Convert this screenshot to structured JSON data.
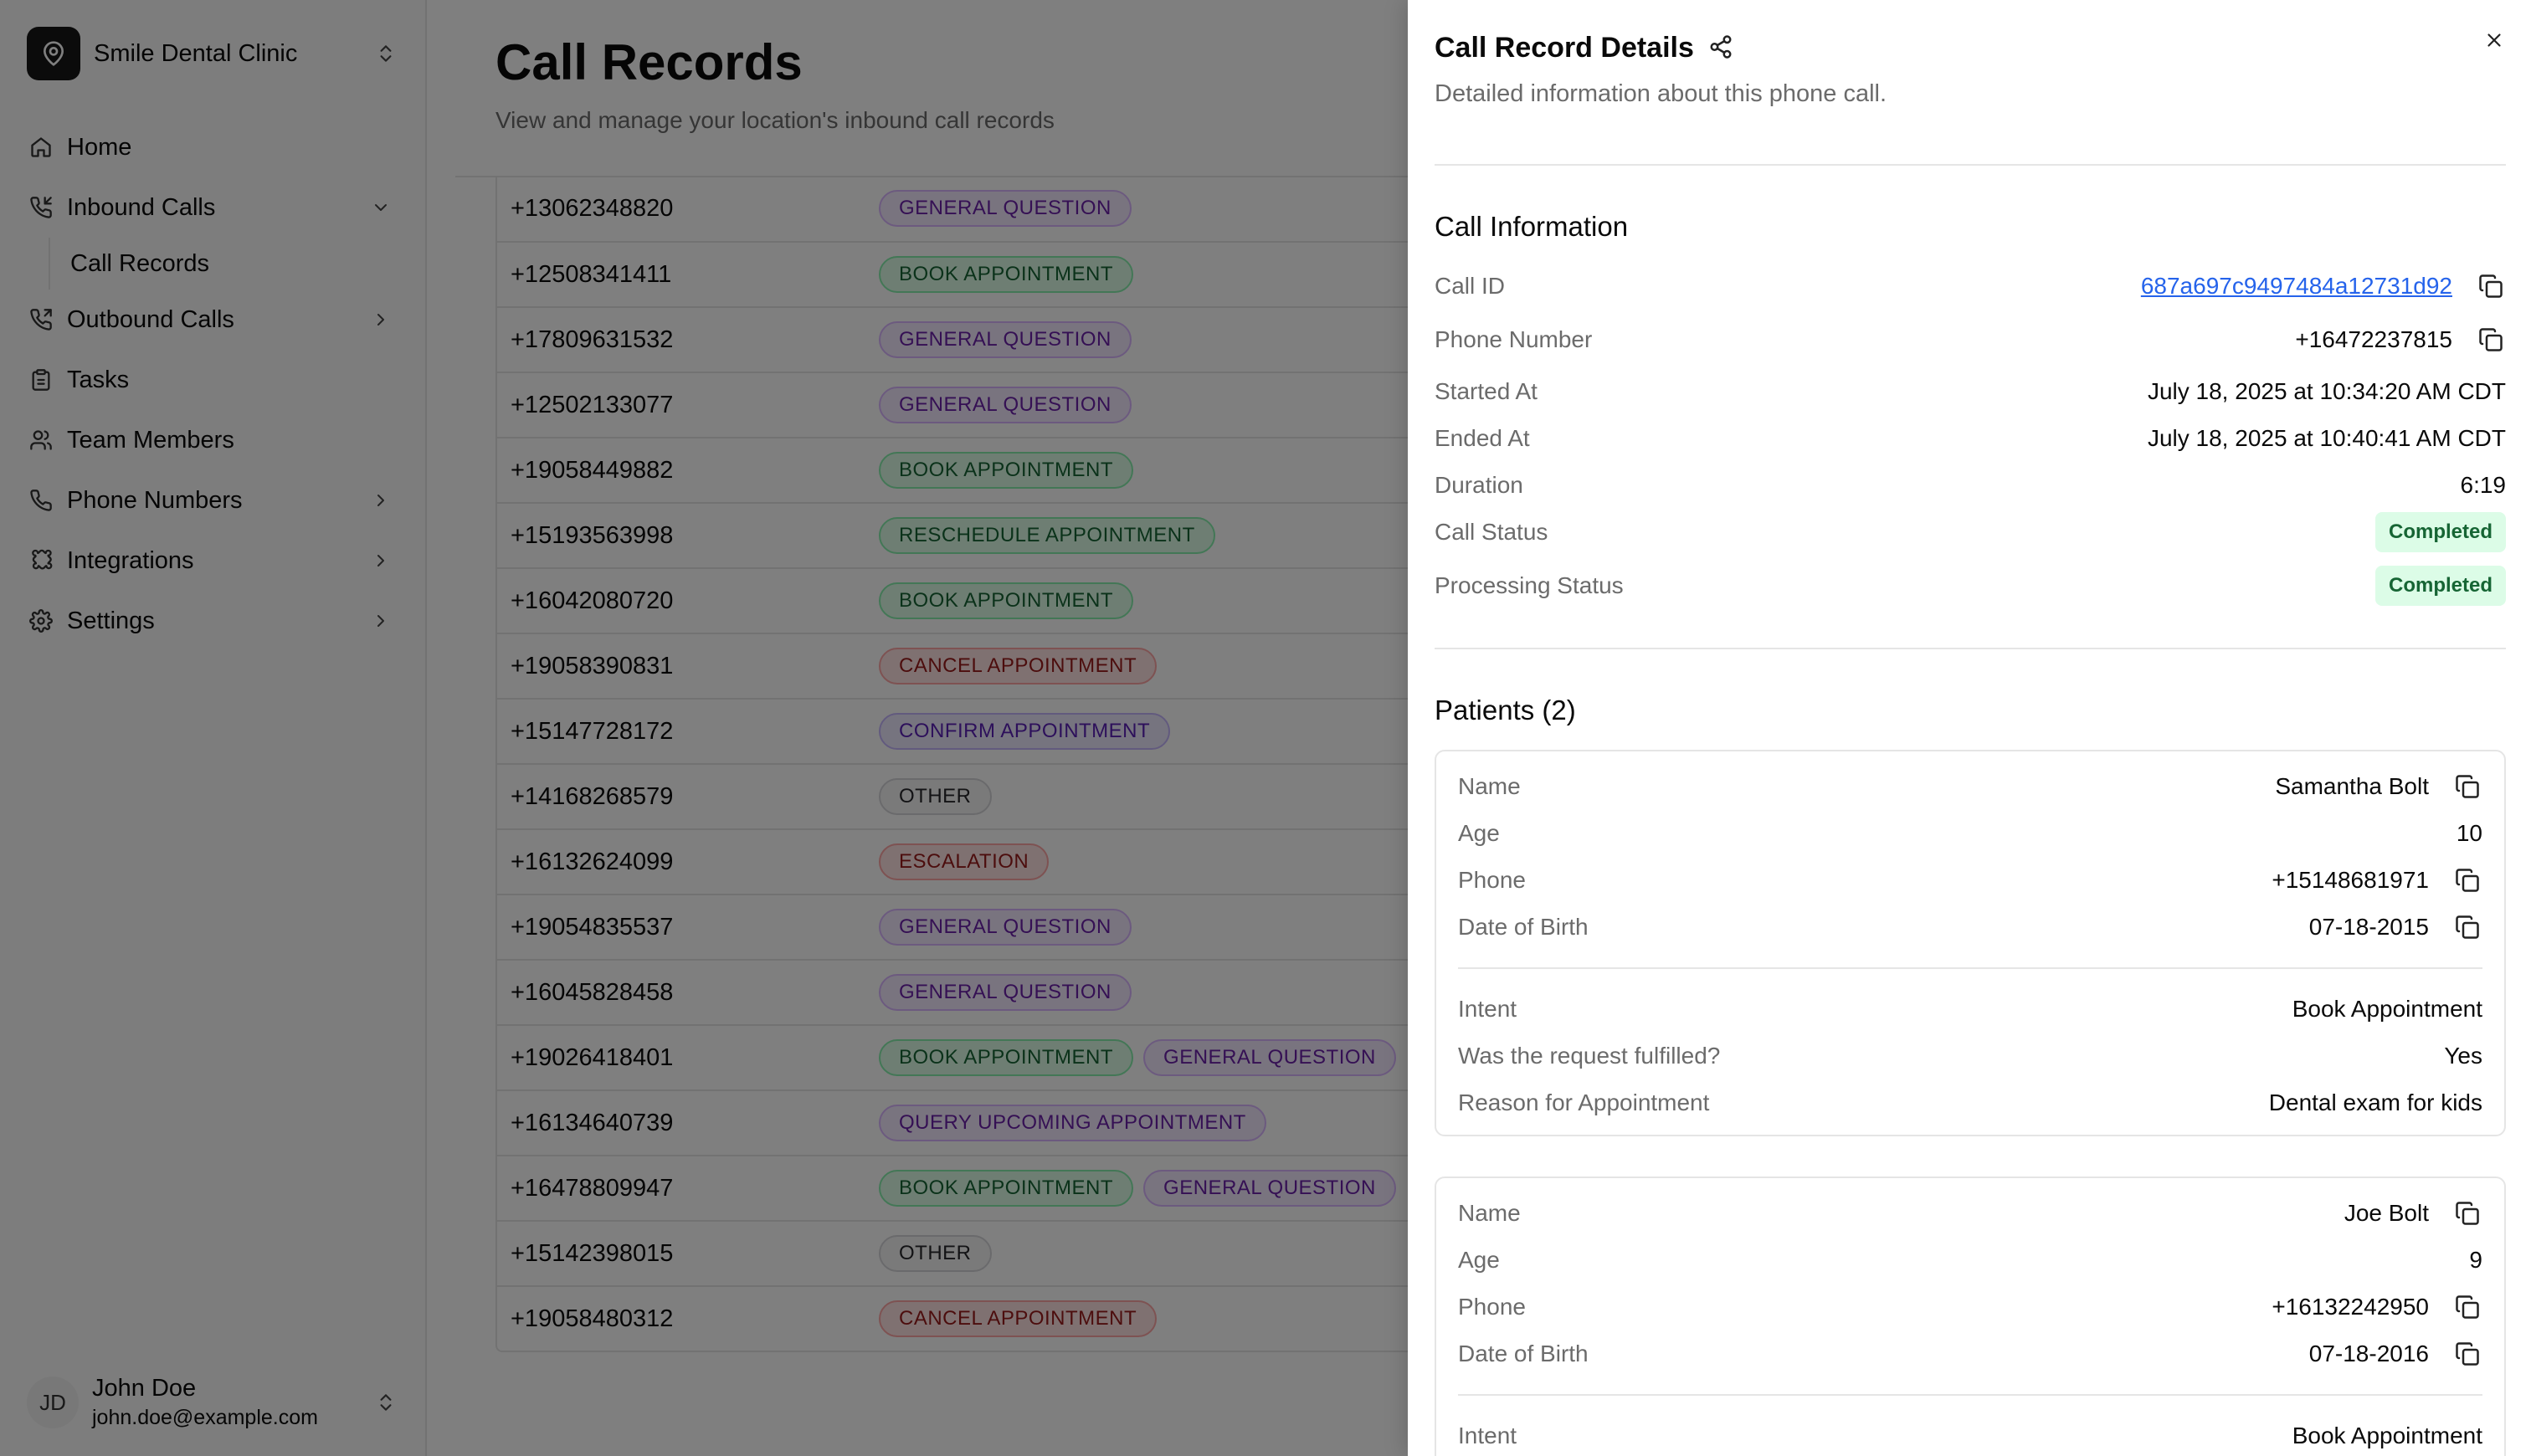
{
  "sidebar": {
    "org_name": "Smile Dental Clinic",
    "nav": {
      "home": "Home",
      "inbound": "Inbound Calls",
      "call_records": "Call Records",
      "outbound": "Outbound Calls",
      "tasks": "Tasks",
      "team": "Team Members",
      "phone_numbers": "Phone Numbers",
      "integrations": "Integrations",
      "settings": "Settings"
    },
    "user": {
      "initials": "JD",
      "name": "John Doe",
      "email": "john.doe@example.com"
    }
  },
  "main": {
    "title": "Call Records",
    "subtitle": "View and manage your location's inbound call records",
    "rows": [
      {
        "phone": "+13062348820",
        "tags": [
          {
            "label": "GENERAL QUESTION",
            "kind": "general"
          }
        ]
      },
      {
        "phone": "+12508341411",
        "tags": [
          {
            "label": "BOOK APPOINTMENT",
            "kind": "book"
          }
        ]
      },
      {
        "phone": "+17809631532",
        "tags": [
          {
            "label": "GENERAL QUESTION",
            "kind": "general"
          }
        ]
      },
      {
        "phone": "+12502133077",
        "tags": [
          {
            "label": "GENERAL QUESTION",
            "kind": "general"
          }
        ]
      },
      {
        "phone": "+19058449882",
        "tags": [
          {
            "label": "BOOK APPOINTMENT",
            "kind": "book"
          }
        ]
      },
      {
        "phone": "+15193563998",
        "tags": [
          {
            "label": "RESCHEDULE APPOINTMENT",
            "kind": "resched"
          }
        ]
      },
      {
        "phone": "+16042080720",
        "tags": [
          {
            "label": "BOOK APPOINTMENT",
            "kind": "book"
          }
        ]
      },
      {
        "phone": "+19058390831",
        "tags": [
          {
            "label": "CANCEL APPOINTMENT",
            "kind": "cancel"
          }
        ]
      },
      {
        "phone": "+15147728172",
        "tags": [
          {
            "label": "CONFIRM APPOINTMENT",
            "kind": "confirm"
          }
        ]
      },
      {
        "phone": "+14168268579",
        "tags": [
          {
            "label": "OTHER",
            "kind": "other"
          }
        ]
      },
      {
        "phone": "+16132624099",
        "tags": [
          {
            "label": "ESCALATION",
            "kind": "escal"
          }
        ]
      },
      {
        "phone": "+19054835537",
        "tags": [
          {
            "label": "GENERAL QUESTION",
            "kind": "general"
          }
        ]
      },
      {
        "phone": "+16045828458",
        "tags": [
          {
            "label": "GENERAL QUESTION",
            "kind": "general"
          }
        ]
      },
      {
        "phone": "+19026418401",
        "tags": [
          {
            "label": "BOOK APPOINTMENT",
            "kind": "book"
          },
          {
            "label": "GENERAL QUESTION",
            "kind": "general"
          }
        ]
      },
      {
        "phone": "+16134640739",
        "tags": [
          {
            "label": "QUERY UPCOMING APPOINTMENT",
            "kind": "query"
          }
        ]
      },
      {
        "phone": "+16478809947",
        "tags": [
          {
            "label": "BOOK APPOINTMENT",
            "kind": "book"
          },
          {
            "label": "GENERAL QUESTION",
            "kind": "general"
          }
        ]
      },
      {
        "phone": "+15142398015",
        "tags": [
          {
            "label": "OTHER",
            "kind": "other"
          }
        ]
      },
      {
        "phone": "+19058480312",
        "tags": [
          {
            "label": "CANCEL APPOINTMENT",
            "kind": "cancel"
          }
        ]
      }
    ]
  },
  "sheet": {
    "title": "Call Record Details",
    "description": "Detailed information about this phone call.",
    "call_info": {
      "title": "Call Information",
      "call_id_label": "Call ID",
      "call_id": "687a697c9497484a12731d92",
      "phone_label": "Phone Number",
      "phone": "+16472237815",
      "started_label": "Started At",
      "started": "July 18, 2025 at 10:34:20 AM CDT",
      "ended_label": "Ended At",
      "ended": "July 18, 2025 at 10:40:41 AM CDT",
      "duration_label": "Duration",
      "duration": "6:19",
      "call_status_label": "Call Status",
      "call_status": "Completed",
      "processing_label": "Processing Status",
      "processing": "Completed"
    },
    "patients": {
      "title": "Patients (2)",
      "labels": {
        "name": "Name",
        "age": "Age",
        "phone": "Phone",
        "dob": "Date of Birth",
        "intent": "Intent",
        "fulfilled": "Was the request fulfilled?",
        "reason": "Reason for Appointment"
      },
      "list": [
        {
          "name": "Samantha Bolt",
          "age": "10",
          "phone": "+15148681971",
          "dob": "07-18-2015",
          "intent": "Book Appointment",
          "fulfilled": "Yes",
          "reason": "Dental exam for kids"
        },
        {
          "name": "Joe Bolt",
          "age": "9",
          "phone": "+16132242950",
          "dob": "07-18-2016",
          "intent": "Book Appointment"
        }
      ]
    }
  },
  "colors": {
    "accent_link": "#2563eb",
    "success_bg": "#dcfce7",
    "success_text": "#166534"
  }
}
